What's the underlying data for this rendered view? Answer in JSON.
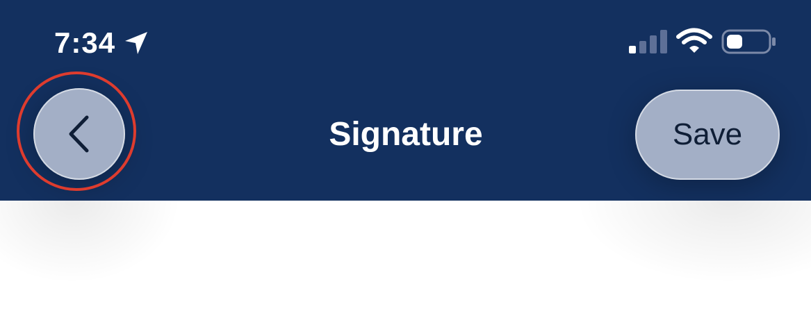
{
  "status_bar": {
    "time": "7:34",
    "icons": [
      "location-arrow-icon",
      "cellular-signal-icon",
      "wifi-icon",
      "battery-icon"
    ]
  },
  "nav_bar": {
    "title": "Signature",
    "back_button_icon": "chevron-left-icon",
    "save_label": "Save"
  },
  "colors": {
    "header_background": "#13305f",
    "button_background": "#a3afc6",
    "highlight_ring": "#de3c2e",
    "content_background": "#ffffff"
  }
}
